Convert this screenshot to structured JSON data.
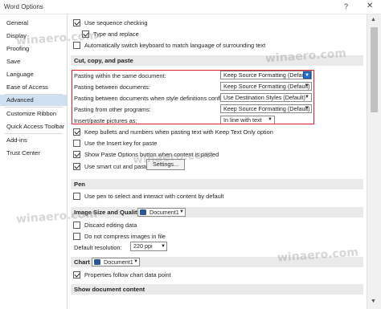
{
  "window": {
    "title": "Word Options",
    "help": "?",
    "close": "✕"
  },
  "sidebar": {
    "items": [
      {
        "label": "General"
      },
      {
        "label": "Display"
      },
      {
        "label": "Proofing"
      },
      {
        "label": "Save"
      },
      {
        "label": "Language"
      },
      {
        "label": "Ease of Access"
      },
      {
        "label": "Advanced",
        "active": true
      },
      {
        "label": "Customize Ribbon"
      },
      {
        "label": "Quick Access Toolbar"
      },
      {
        "label": "Add-ins"
      },
      {
        "label": "Trust Center"
      }
    ]
  },
  "editing": {
    "use_sequence_checking": "Use sequence checking",
    "type_and_replace": "Type and replace",
    "auto_switch_keyboard": "Automatically switch keyboard to match language of surrounding text"
  },
  "cut_copy_paste": {
    "header": "Cut, copy, and paste",
    "rows": [
      {
        "label": "Pasting within the same document:",
        "value": "Keep Source Formatting (Default)"
      },
      {
        "label": "Pasting between documents:",
        "value": "Keep Source Formatting (Default)"
      },
      {
        "label": "Pasting between documents when style definitions conflict:",
        "value": "Use Destination Styles (Default)"
      },
      {
        "label": "Pasting from other programs:",
        "value": "Keep Source Formatting (Default)"
      },
      {
        "label": "Insert/paste pictures as:",
        "value": "In line with text"
      }
    ],
    "keep_bullets": "Keep bullets and numbers when pasting text with Keep Text Only option",
    "use_insert_key": "Use the Insert key for paste",
    "show_paste_options": "Show Paste Options button when content is pasted",
    "use_smart_cut": "Use smart cut and paste",
    "settings_button": "Settings..."
  },
  "pen": {
    "header": "Pen",
    "use_pen": "Use pen to select and interact with content by default"
  },
  "image_size": {
    "header": "Image Size and Quality",
    "document": "Document1",
    "discard_editing": "Discard editing data",
    "no_compress": "Do not compress images in file",
    "default_resolution_label": "Default resolution:",
    "default_resolution_value": "220 ppi"
  },
  "chart": {
    "header": "Chart",
    "document": "Document1",
    "properties_follow": "Properties follow chart data point"
  },
  "show_document_content": {
    "header": "Show document content"
  },
  "watermarks": [
    "winaero.com",
    "winaero.com",
    "winaero.com",
    "winaero.com",
    "winaero.com"
  ]
}
